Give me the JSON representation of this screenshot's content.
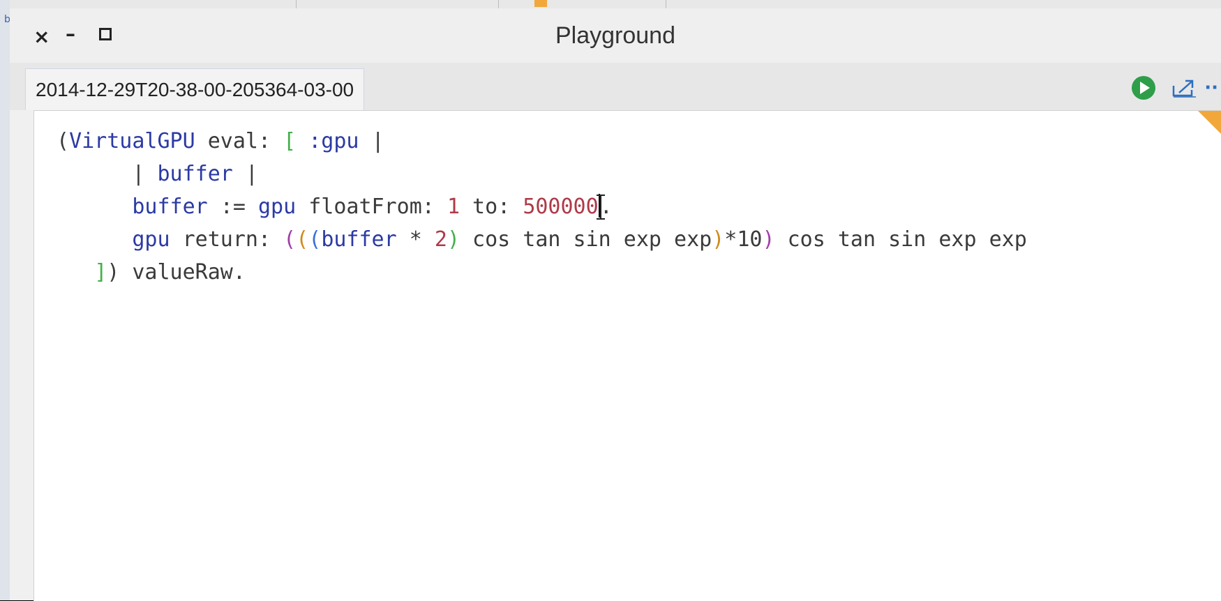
{
  "window": {
    "title": "Playground",
    "controls": {
      "close": "×",
      "minimize": "–",
      "maximize": ""
    }
  },
  "tab": {
    "label": "2014-12-29T20-38-00-205364-03-00"
  },
  "toolbar": {
    "run_icon": "play-circle-icon",
    "share_icon": "share-icon",
    "more": "··"
  },
  "colors": {
    "accent": "#f2a73b",
    "run_green": "#2e9e4a",
    "keyword_blue": "#2b3aa4",
    "number_red": "#b03a48",
    "bracket_green": "#44b04a",
    "paren_purple": "#a13ea8"
  },
  "code": {
    "line1": {
      "open": "(",
      "receiver": "VirtualGPU",
      "msg": " eval: ",
      "bracket": "[",
      "arg": " :gpu ",
      "bar": "|"
    },
    "line2": {
      "indent": "      ",
      "bar1": "| ",
      "temp": "buffer",
      "bar2": " |"
    },
    "line3": {
      "indent": "      ",
      "var": "buffer",
      "assign": " := ",
      "gpu": "gpu",
      "msg1": " floatFrom: ",
      "n1": "1",
      "msg2": " to: ",
      "n2": "500000",
      "dot": "."
    },
    "line4": {
      "indent": "      ",
      "gpu": "gpu",
      "msg": " return: ",
      "p1": "(",
      "p2": "(",
      "p3": "(",
      "var": "buffer",
      "op": " * ",
      "n": "2",
      "p3c": ")",
      "ops1": " cos tan sin exp exp",
      "p2c": ")",
      "mul": "*10",
      "p1c": ")",
      "ops2": " cos tan sin exp exp"
    },
    "line5": {
      "indent": "   ",
      "bracket": "]",
      "close": ")",
      "tail": " valueRaw."
    }
  }
}
